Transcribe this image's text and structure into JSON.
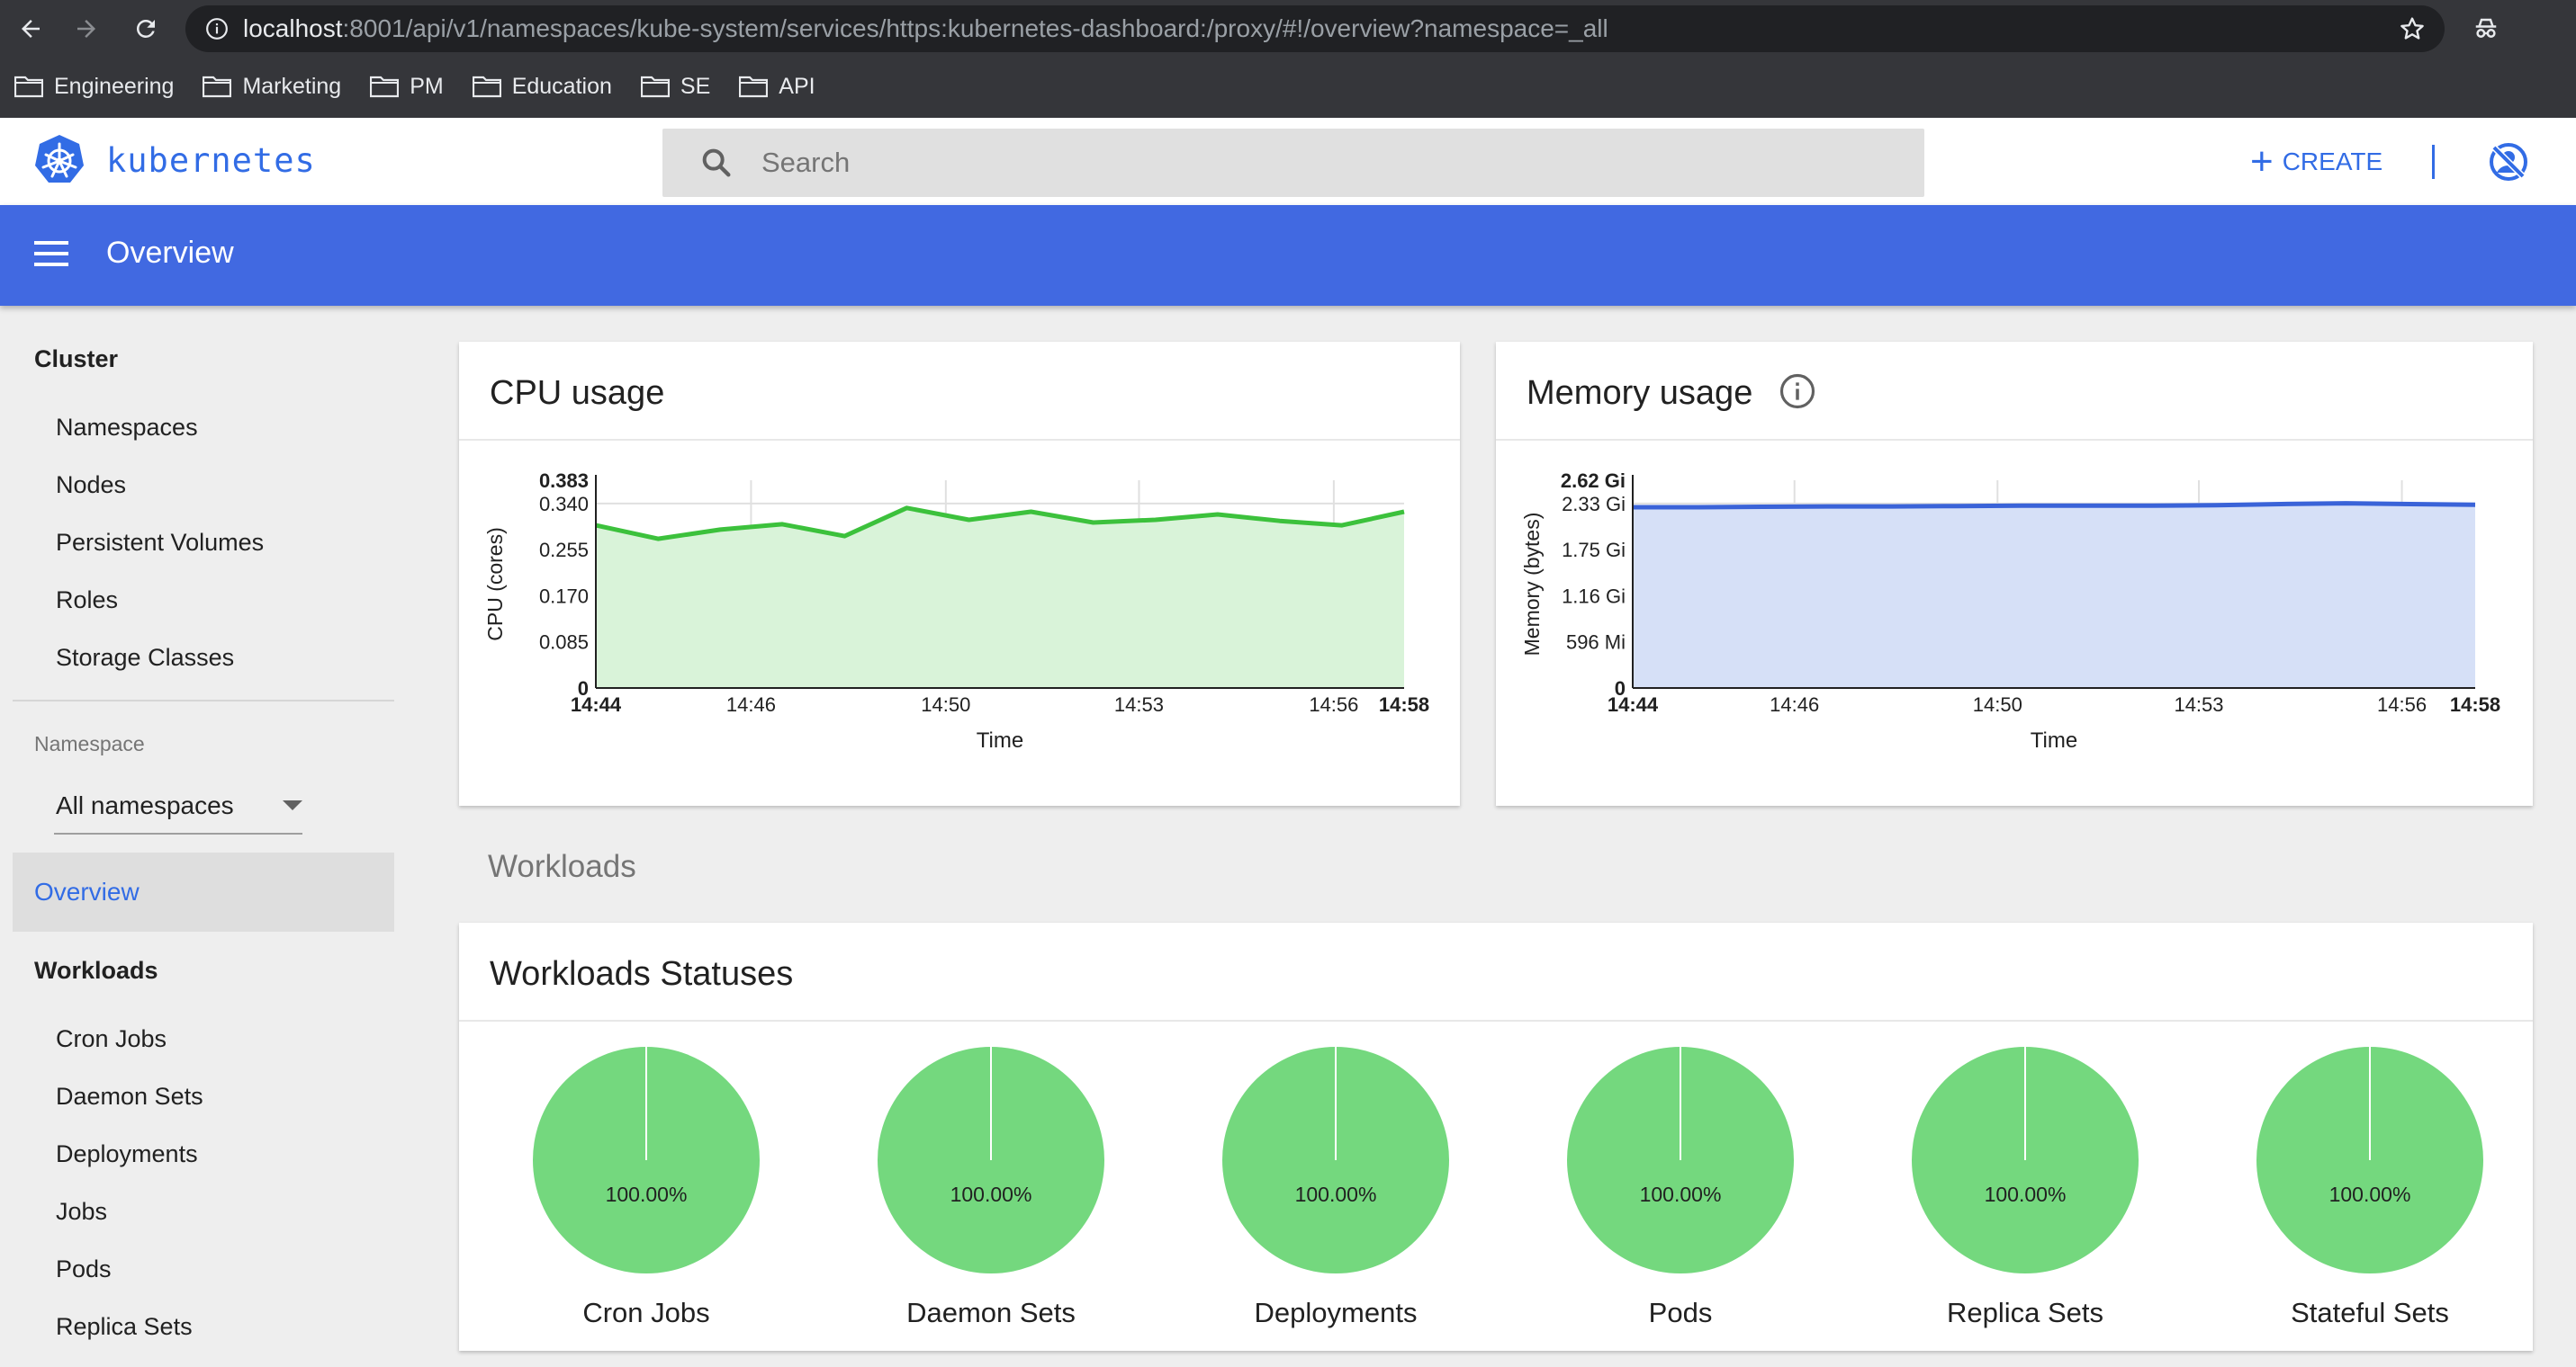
{
  "browser": {
    "url_host": "localhost",
    "url_rest": ":8001/api/v1/namespaces/kube-system/services/https:kubernetes-dashboard:/proxy/#!/overview?namespace=_all",
    "bookmarks": [
      "Engineering",
      "Marketing",
      "PM",
      "Education",
      "SE",
      "API"
    ]
  },
  "header": {
    "logo_text": "kubernetes",
    "search_placeholder": "Search",
    "create_label": "CREATE"
  },
  "toolbar": {
    "title": "Overview"
  },
  "sidebar": {
    "cluster_heading": "Cluster",
    "cluster_items": [
      "Namespaces",
      "Nodes",
      "Persistent Volumes",
      "Roles",
      "Storage Classes"
    ],
    "namespace_label": "Namespace",
    "namespace_value": "All namespaces",
    "overview_label": "Overview",
    "workloads_heading": "Workloads",
    "workload_items": [
      "Cron Jobs",
      "Daemon Sets",
      "Deployments",
      "Jobs",
      "Pods",
      "Replica Sets"
    ]
  },
  "colors": {
    "brand": "#326ce5",
    "toolbar": "#4169e1",
    "cpu_line": "#3cc13c",
    "cpu_fill": "#d9f3d9",
    "mem_line": "#3a63d8",
    "mem_fill": "#d6e0f7",
    "pie_fill": "#74d87e"
  },
  "workloads_heading": "Workloads",
  "chart_data": [
    {
      "type": "area",
      "title": "CPU usage",
      "xlabel": "Time",
      "ylabel": "CPU (cores)",
      "x_ticks": [
        "14:44",
        "14:46",
        "14:50",
        "14:53",
        "14:56",
        "14:58"
      ],
      "x_ticks_bold": [
        "14:44",
        "14:58"
      ],
      "y_ticks": [
        "0",
        "0.085",
        "0.170",
        "0.255",
        "0.340",
        "0.383"
      ],
      "y_ticks_bold": [
        "0",
        "0.383"
      ],
      "ylim": [
        0,
        0.383
      ],
      "x": [
        0,
        0.66,
        1.9,
        2.87,
        3.35,
        4.3,
        5.16,
        6.8,
        7.85,
        8.8,
        10.1,
        11.2,
        12.05,
        12.86,
        14.0
      ],
      "values": [
        0.3,
        0.275,
        0.292,
        0.302,
        0.28,
        0.332,
        0.31,
        0.325,
        0.305,
        0.31,
        0.32,
        0.308,
        0.3,
        0.325
      ],
      "x_data": [
        0,
        1,
        2,
        3,
        4,
        5,
        6,
        7,
        8,
        9,
        10,
        11,
        12,
        13
      ],
      "y": [
        0.3,
        0.275,
        0.292,
        0.302,
        0.28,
        0.332,
        0.31,
        0.325,
        0.305,
        0.31,
        0.32,
        0.308,
        0.3,
        0.325
      ],
      "grid": true
    },
    {
      "type": "area",
      "title": "Memory usage",
      "xlabel": "Time",
      "ylabel": "Memory (bytes)",
      "x_ticks": [
        "14:44",
        "14:46",
        "14:50",
        "14:53",
        "14:56",
        "14:58"
      ],
      "x_ticks_bold": [
        "14:44",
        "14:58"
      ],
      "y_ticks": [
        "0",
        "596 Mi",
        "1.16 Gi",
        "1.75 Gi",
        "2.33 Gi",
        "2.62 Gi"
      ],
      "y_ticks_bold": [
        "0",
        "2.62 Gi"
      ],
      "ylim": [
        0,
        2.62
      ],
      "y": [
        2.28,
        2.28,
        2.285,
        2.29,
        2.29,
        2.295,
        2.3,
        2.3,
        2.3,
        2.305,
        2.32,
        2.33,
        2.32,
        2.31
      ],
      "grid": true
    },
    {
      "type": "pie",
      "title": "Workloads Statuses",
      "categories": [
        "Cron Jobs",
        "Daemon Sets",
        "Deployments",
        "Pods",
        "Replica Sets",
        "Stateful Sets"
      ],
      "values": [
        100,
        100,
        100,
        100,
        100,
        100
      ],
      "labels": [
        "100.00%",
        "100.00%",
        "100.00%",
        "100.00%",
        "100.00%",
        "100.00%"
      ]
    }
  ]
}
